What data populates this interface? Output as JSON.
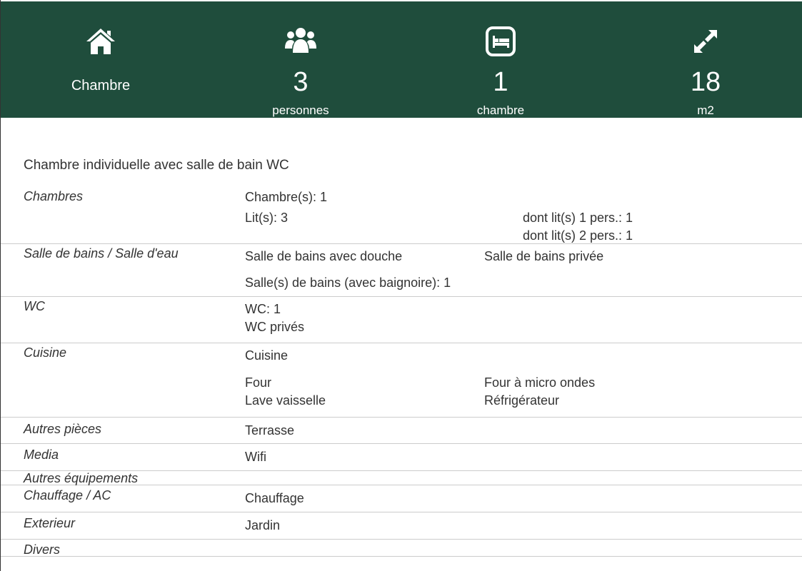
{
  "header": {
    "type_label": "Chambre",
    "persons": {
      "value": "3",
      "unit": "personnes"
    },
    "bedrooms": {
      "value": "1",
      "unit": "chambre"
    },
    "area": {
      "value": "18",
      "unit": "m2"
    },
    "icons": [
      "home-icon",
      "people-icon",
      "bed-icon",
      "expand-icon"
    ],
    "background_color": "#1f4d3c"
  },
  "description": "Chambre individuelle avec salle de bain WC",
  "rows": {
    "chambres": {
      "label": "Chambres",
      "rooms": "Chambre(s): 1",
      "beds": "Lit(s):  3",
      "single_beds": "dont lit(s) 1 pers.: 1",
      "double_beds": "dont lit(s) 2 pers.: 1"
    },
    "salle_de_bains": {
      "label": "Salle de bains / Salle d'eau",
      "shower": "Salle de bains avec douche",
      "private": "Salle de bains privée",
      "bathtub": "Salle(s) de bains (avec baignoire):  1"
    },
    "wc": {
      "label": "WC",
      "count": "WC:  1",
      "private": "WC privés"
    },
    "cuisine": {
      "label": "Cuisine",
      "kitchen": "Cuisine",
      "oven": "Four",
      "microwave": "Four à micro ondes",
      "dishwasher": "Lave vaisselle",
      "fridge": "Réfrigérateur"
    },
    "autres_pieces": {
      "label": "Autres pièces",
      "value": "Terrasse"
    },
    "media": {
      "label": "Media",
      "value": "Wifi"
    },
    "autres_equipements": {
      "label": "Autres équipements"
    },
    "chauffage": {
      "label": "Chauffage / AC",
      "value": "Chauffage"
    },
    "exterieur": {
      "label": "Exterieur",
      "value": "Jardin"
    },
    "divers": {
      "label": "Divers"
    }
  }
}
